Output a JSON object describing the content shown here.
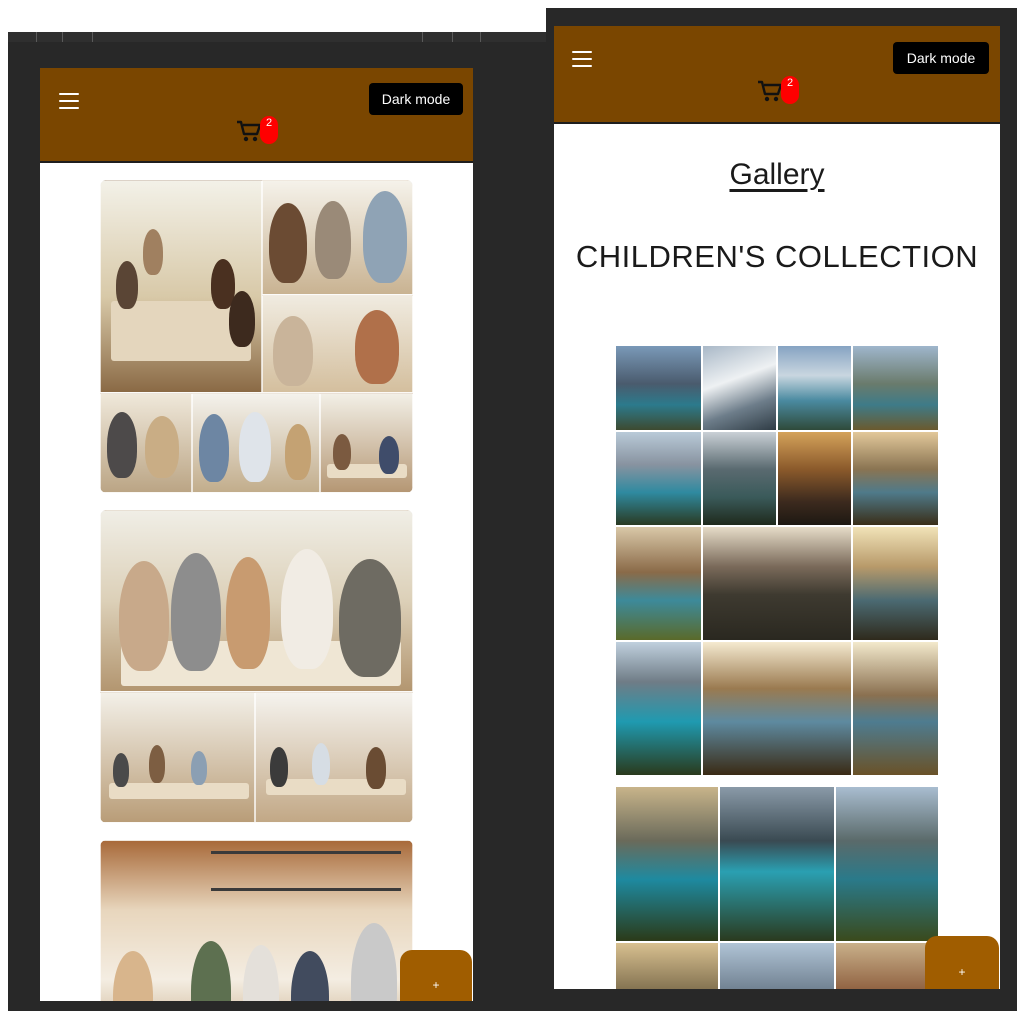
{
  "left_screen": {
    "header": {
      "menu_icon": "hamburger-icon",
      "dark_mode_label": "Dark mode",
      "cart_icon": "cart-icon",
      "cart_count": "2",
      "bg_color": "#7a4600"
    },
    "fab_label": "+"
  },
  "right_screen": {
    "header": {
      "menu_icon": "hamburger-icon",
      "dark_mode_label": "Dark mode",
      "cart_icon": "cart-icon",
      "cart_count": "2",
      "bg_color": "#7a4600"
    },
    "gallery_title": "Gallery",
    "collection_title": "CHILDREN'S COLLECTION",
    "fab_label": "+"
  }
}
